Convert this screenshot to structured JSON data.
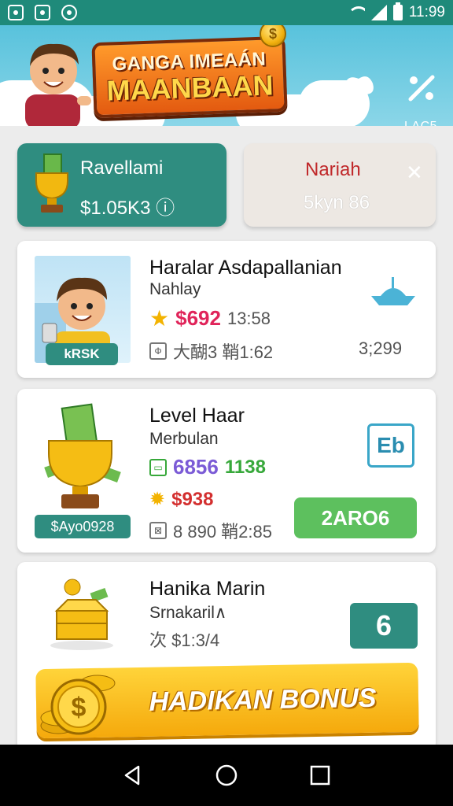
{
  "status_bar": {
    "time": "11:99",
    "icons": [
      "notification-icon",
      "gallery-icon",
      "sync-icon",
      "wifi-icon",
      "signal-icon",
      "battery-icon"
    ]
  },
  "header": {
    "banner_line1": "GANGA IMEAÁN",
    "banner_line2": "MAANBAAN",
    "right_label": "LAC5"
  },
  "tabs": [
    {
      "title": "Ravellami",
      "value": "$1.05K3 ⓘ"
    },
    {
      "title": "Nariah",
      "value": "5kyn 86"
    }
  ],
  "cards": [
    {
      "name": "Haralar Asdapallanian",
      "sub": "Nahlay",
      "tag": "kRSK",
      "price": "$692",
      "price_extra": "13:58",
      "meta": "大醐3  鞘1:62",
      "meta_right": "3;299"
    },
    {
      "name": "Level Haar",
      "sub": "Merbulan",
      "tag": "$Ayo0928",
      "value1": "6856",
      "value2": "1138",
      "price": "$938",
      "meta": "8 890  鞘2:85",
      "side_button": "Eb",
      "action_button": "2ARO6"
    },
    {
      "name": "Hanika Marin",
      "sub": "Srnakaril∧",
      "meta": "次  $1:3/4",
      "count": "6",
      "bonus_button": "HADIKAN BONUS"
    }
  ],
  "colors": {
    "teal": "#2f8d80",
    "status_bar": "#1f8a7a",
    "header_sky": "#58c2dc",
    "green_button": "#5dc05e",
    "gold": "#f5a90c"
  }
}
